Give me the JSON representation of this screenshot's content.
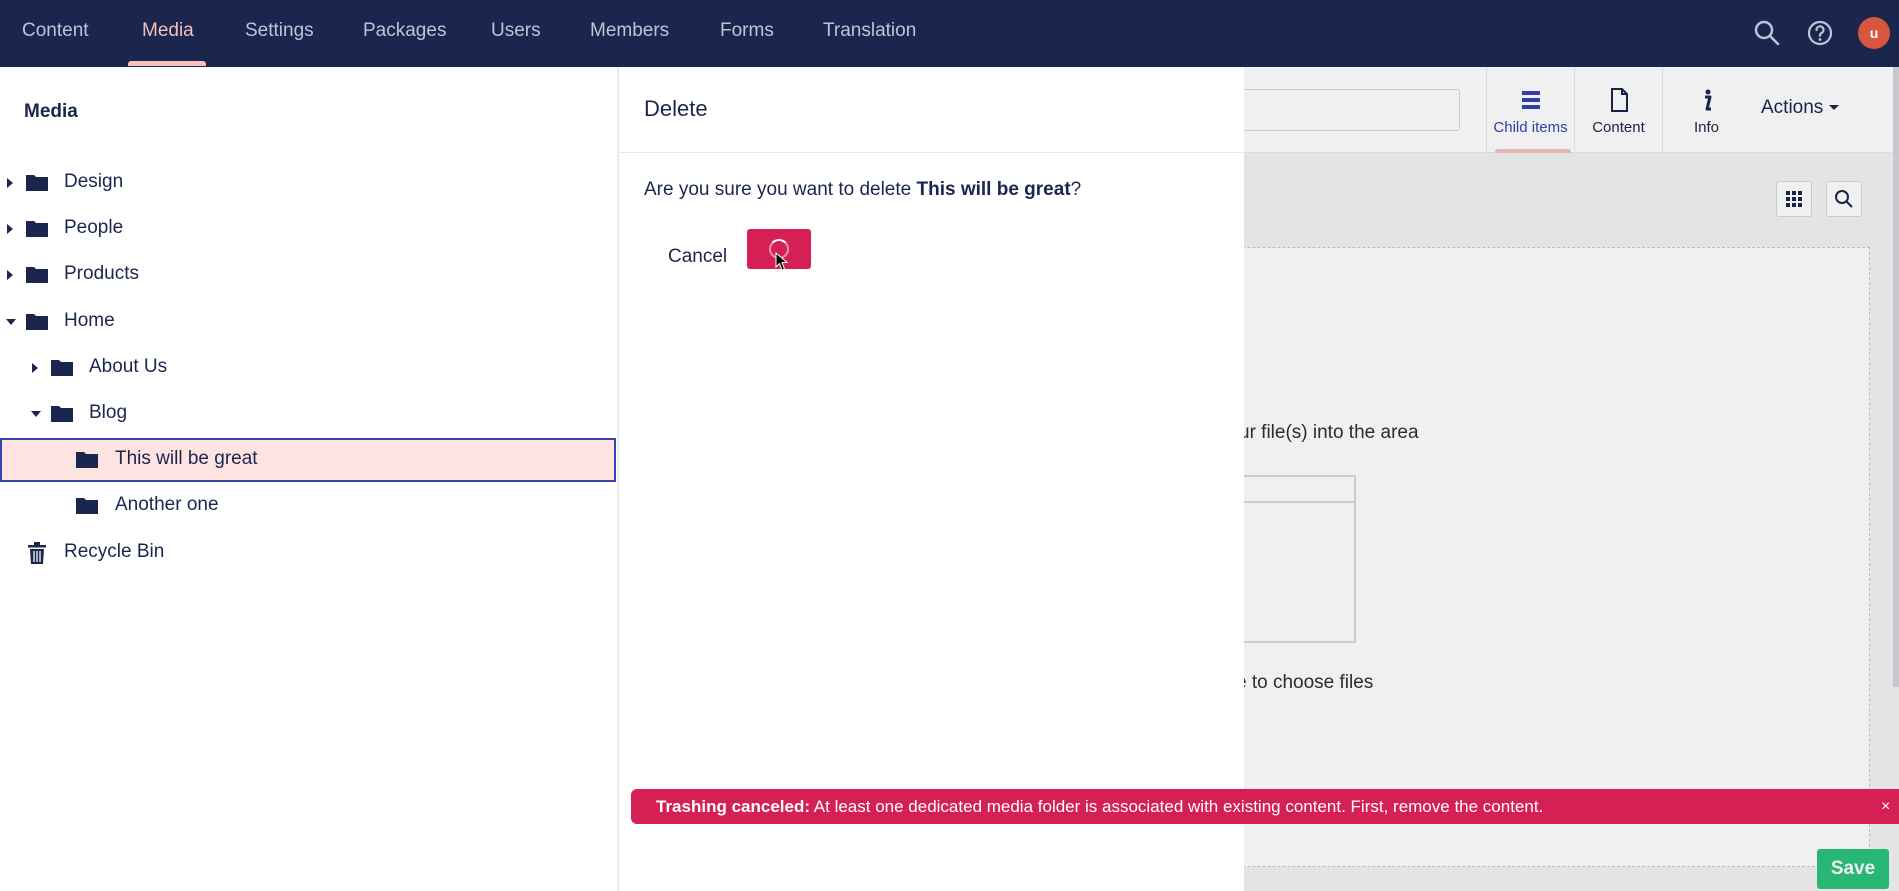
{
  "nav": {
    "items": [
      "Content",
      "Media",
      "Settings",
      "Packages",
      "Users",
      "Members",
      "Forms",
      "Translation"
    ],
    "active": "Media"
  },
  "user": {
    "avatar_initials": "u"
  },
  "tree": {
    "title": "Media",
    "items": [
      {
        "label": "Design",
        "expanded": false,
        "has_children": true,
        "icon": "folder-icon"
      },
      {
        "label": "People",
        "expanded": false,
        "has_children": true,
        "icon": "folder-icon"
      },
      {
        "label": "Products",
        "expanded": false,
        "has_children": true,
        "icon": "folder-icon"
      },
      {
        "label": "Home",
        "expanded": true,
        "has_children": true,
        "icon": "folder-icon"
      },
      {
        "label": "About Us",
        "expanded": false,
        "has_children": true,
        "icon": "folder-icon"
      },
      {
        "label": "Blog",
        "expanded": true,
        "has_children": true,
        "icon": "folder-icon"
      },
      {
        "label": "This will be great",
        "selected": true,
        "icon": "folder-icon"
      },
      {
        "label": "Another one",
        "icon": "folder-icon"
      },
      {
        "label": "Recycle Bin",
        "icon": "trash-icon"
      }
    ]
  },
  "editor": {
    "tabs": [
      {
        "label": "Child items",
        "icon": "list-icon",
        "active": true
      },
      {
        "label": "Content",
        "icon": "document-icon"
      },
      {
        "label": "Info",
        "icon": "info-icon"
      }
    ],
    "actions_label": "Actions",
    "drop_text_1": "ur file(s) into the area",
    "drop_text_2": "e to choose files",
    "save_label": "Save"
  },
  "dialog": {
    "title": "Delete",
    "question_prefix": "Are you sure you want to delete ",
    "item_name": "This will be great",
    "question_suffix": "?",
    "cancel_label": "Cancel"
  },
  "notification": {
    "title": "Trashing canceled:",
    "message": " At least one dedicated media folder is associated with existing content. First, remove the content.",
    "close_icon": "×"
  },
  "colors": {
    "topbar": "#1b264f",
    "accent": "#d42054",
    "active_nav": "#f5c1bc",
    "selected_row": "#fee4e1",
    "save": "#2bc37c"
  }
}
